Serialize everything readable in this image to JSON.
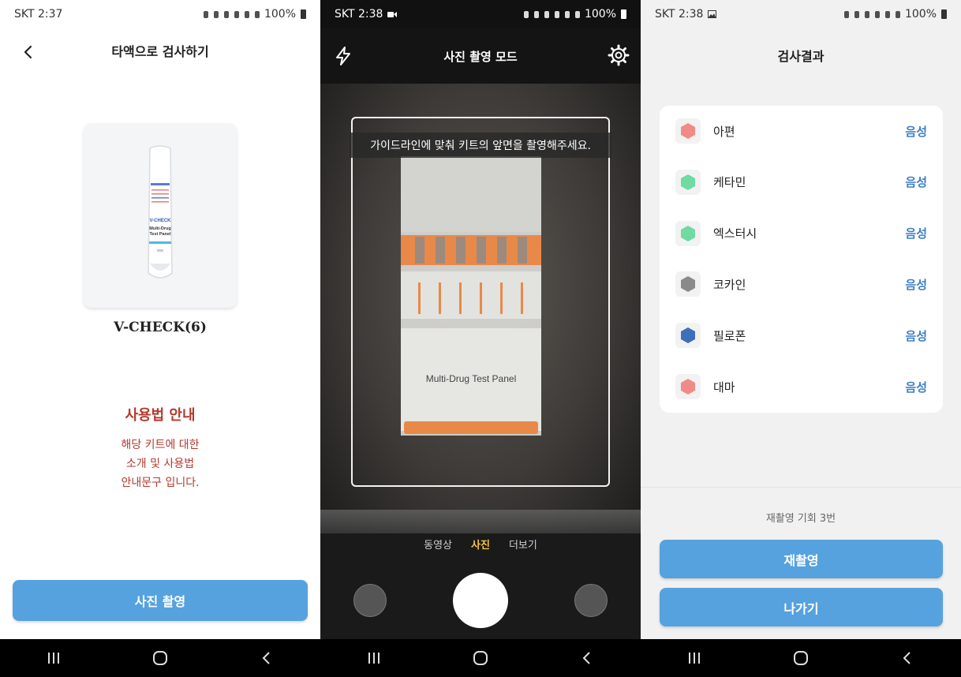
{
  "status_bars": [
    {
      "carrier": "SKT 2:37",
      "battery": "100%"
    },
    {
      "carrier": "SKT 2:38",
      "battery": "100%"
    },
    {
      "carrier": "SKT 2:38",
      "battery": "100%"
    }
  ],
  "screen1": {
    "title": "타액으로 검사하기",
    "kit_name": "V-CHECK(6)",
    "kit_image_brand": "V-CHECK",
    "kit_image_text": [
      "Multi-Drug",
      "Test Panel"
    ],
    "guide_title": "사용법 안내",
    "guide_lines": [
      "해당 키트에 대한",
      "소개 및 사용법",
      "안내문구 입니다."
    ],
    "button_label": "사진 촬영",
    "accent_color": "#56a2df",
    "guide_color": "#b33a2e"
  },
  "screen2": {
    "title": "사진 촬영 모드",
    "guide_tip": "가이드라인에 맞춰 키트의 앞면을 촬영해주세요.",
    "kit_label": "Multi-Drug Test Panel",
    "modes": [
      {
        "label": "동영상",
        "active": false
      },
      {
        "label": "사진",
        "active": true
      },
      {
        "label": "더보기",
        "active": false
      }
    ],
    "active_mode_color": "#f6c342"
  },
  "screen3": {
    "title": "검사결과",
    "results": [
      {
        "drug": "아편",
        "result": "음성",
        "color": "#f08c88"
      },
      {
        "drug": "케타민",
        "result": "음성",
        "color": "#6fdba0"
      },
      {
        "drug": "엑스터시",
        "result": "음성",
        "color": "#6fdba0"
      },
      {
        "drug": "코카인",
        "result": "음성",
        "color": "#8a8a8a"
      },
      {
        "drug": "필로폰",
        "result": "음성",
        "color": "#3f6fb8"
      },
      {
        "drug": "대마",
        "result": "음성",
        "color": "#f08c88"
      }
    ],
    "retry_info": "재촬영 기회 3번",
    "retake_button": "재촬영",
    "exit_button": "나가기",
    "result_color": "#3d7fc6"
  },
  "icons": {
    "back": "chevron-left-icon",
    "flash": "flash-icon",
    "settings": "gear-icon",
    "nav_recent": "recent-apps-icon",
    "nav_home": "home-icon",
    "nav_back": "back-icon"
  }
}
